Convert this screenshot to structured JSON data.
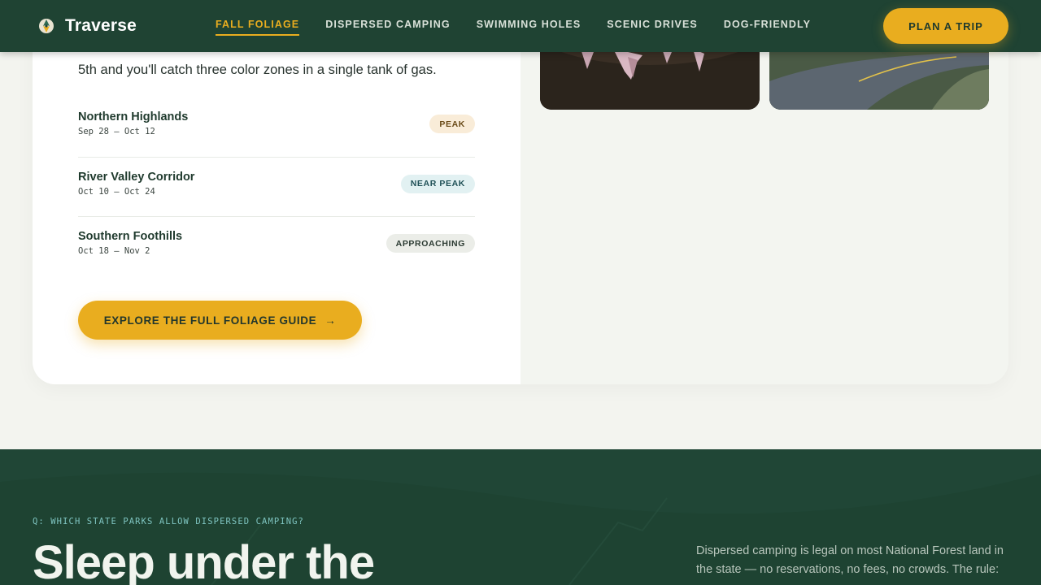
{
  "nav": {
    "brand": "Traverse",
    "links": [
      "Fall Foliage",
      "Dispersed Camping",
      "Swimming Holes",
      "Scenic Drives",
      "Dog-Friendly"
    ],
    "active_index": 0,
    "plan_button": "Plan a Trip"
  },
  "foliage": {
    "intro_line": "5th and you'll catch three color zones in a single tank of gas.",
    "zones": [
      {
        "name": "Northern Highlands",
        "dates": "Sep 28 – Oct 12",
        "status": "Peak"
      },
      {
        "name": "River Valley Corridor",
        "dates": "Oct 10 – Oct 24",
        "status": "Near Peak"
      },
      {
        "name": "Southern Foothills",
        "dates": "Oct 18 – Nov 2",
        "status": "Approaching"
      }
    ],
    "explore_button": "Explore the full foliage guide",
    "explore_arrow": "→"
  },
  "camping": {
    "question": "Q: Which state parks allow dispersed camping?",
    "headline": "Sleep under the",
    "paragraph": "Dispersed camping is legal on most National Forest land in the state — no reservations, no fees, no crowds. The rule:"
  },
  "colors": {
    "nav_bg": "#1f4333",
    "accent": "#e9ad1f",
    "dark_section": "#1e4332"
  },
  "icons": {
    "brand": "pine-compass-icon",
    "arrow": "arrow-right-icon"
  }
}
